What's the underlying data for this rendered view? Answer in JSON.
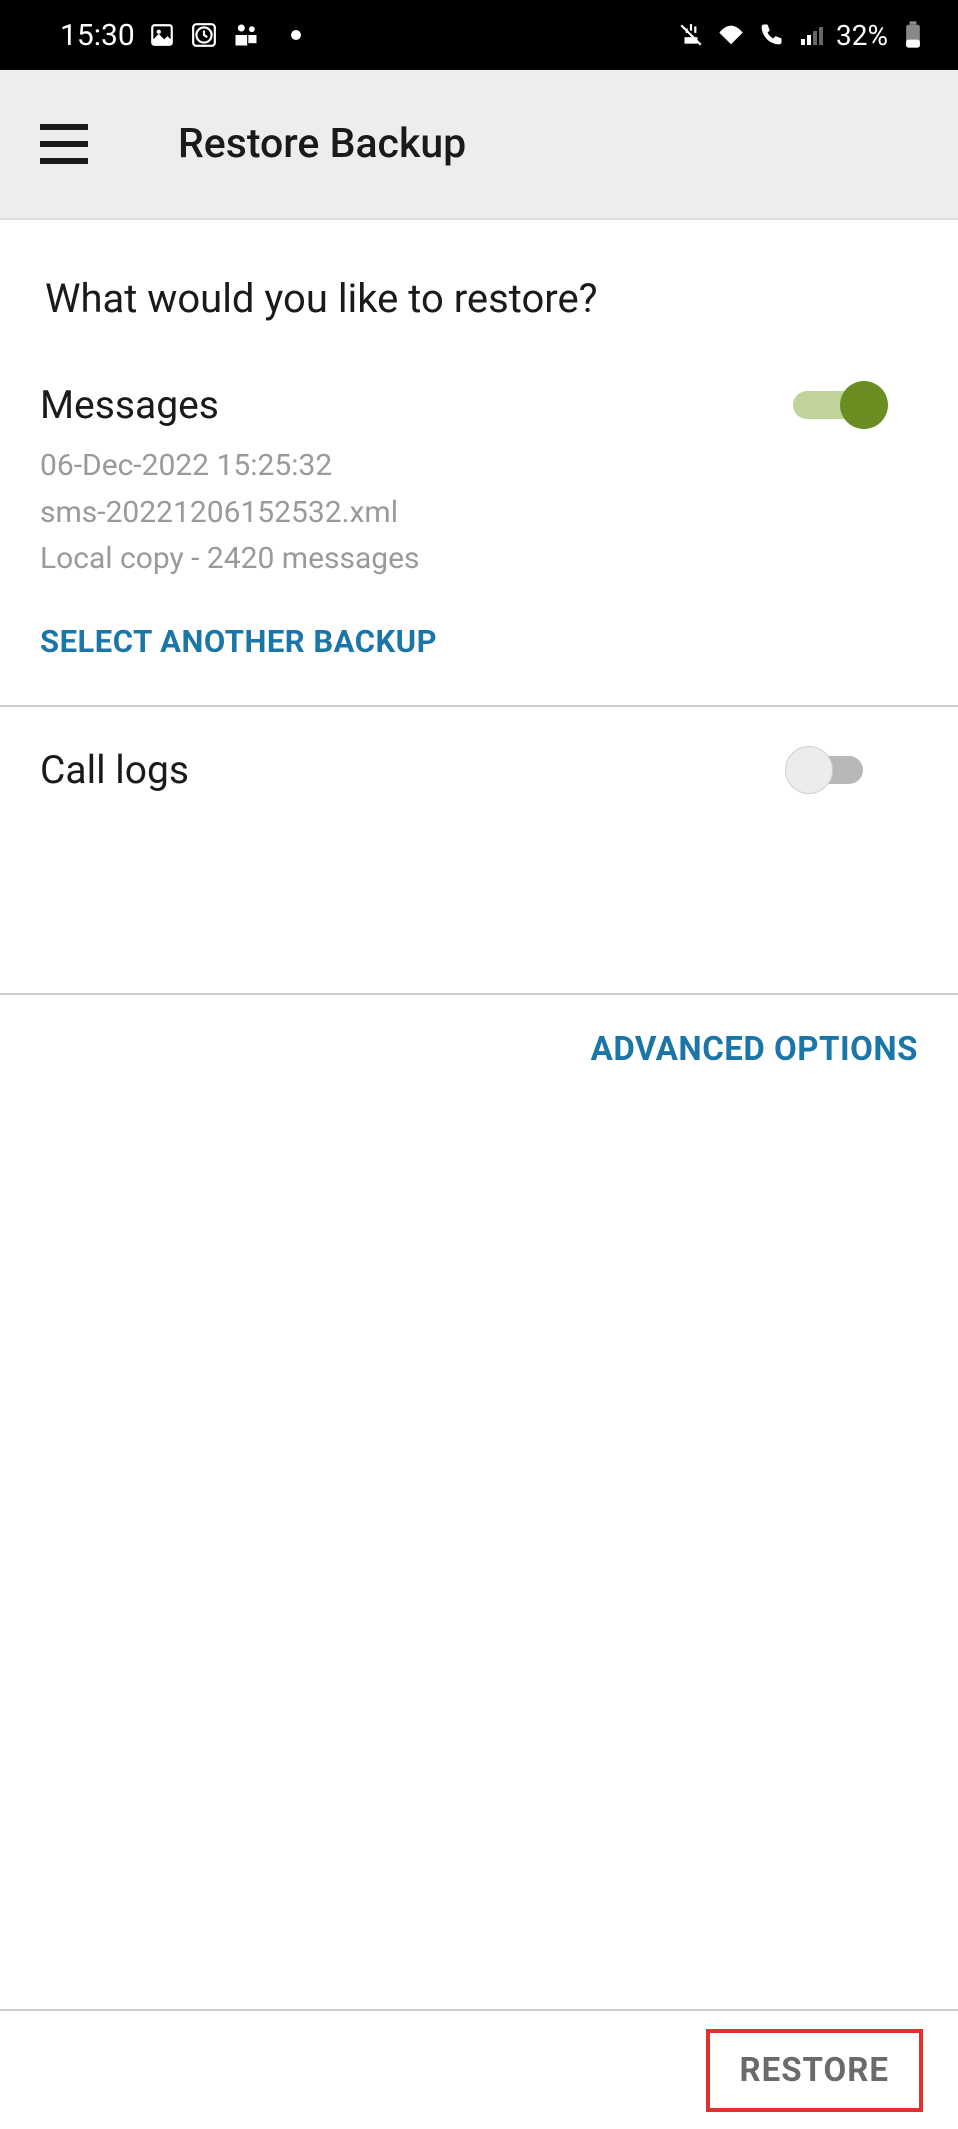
{
  "status_bar": {
    "time": "15:30",
    "battery_percent": "32%"
  },
  "app_bar": {
    "title": "Restore Backup"
  },
  "prompt": "What would you like to restore?",
  "messages": {
    "title": "Messages",
    "date": "06-Dec-2022 15:25:32",
    "filename": "sms-20221206152532.xml",
    "summary": "Local copy - 2420 messages",
    "select_another": "SELECT ANOTHER BACKUP",
    "toggle_on": true
  },
  "call_logs": {
    "title": "Call logs",
    "toggle_on": false
  },
  "advanced_options": "ADVANCED OPTIONS",
  "restore_button": "RESTORE"
}
